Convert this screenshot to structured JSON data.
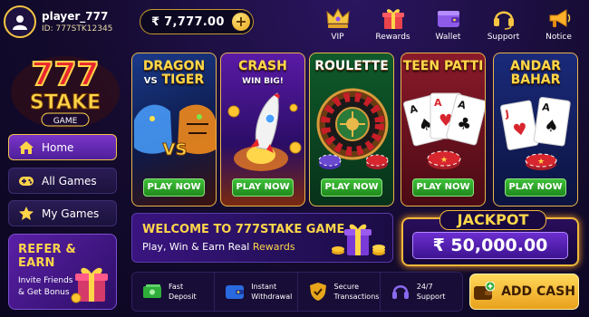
{
  "profile": {
    "username": "player_777",
    "id_text": "ID: 777STK12345"
  },
  "wallet": {
    "balance": "₹ 7,777.00",
    "add_symbol": "+"
  },
  "topnav": [
    {
      "label": "VIP",
      "icon": "crown-icon"
    },
    {
      "label": "Rewards",
      "icon": "gift-icon"
    },
    {
      "label": "Wallet",
      "icon": "wallet-icon"
    },
    {
      "label": "Support",
      "icon": "headset-icon"
    },
    {
      "label": "Notice",
      "icon": "megaphone-icon"
    }
  ],
  "logo": {
    "line1": "777",
    "line2": "STAKE",
    "line3": "GAME"
  },
  "sidebar": {
    "items": [
      {
        "label": "Home",
        "icon": "home-icon",
        "active": true
      },
      {
        "label": "All Games",
        "icon": "gamepad-icon",
        "active": false
      },
      {
        "label": "My Games",
        "icon": "star-icon",
        "active": false
      }
    ],
    "refer": {
      "title": "REFER & EARN",
      "subtitle": "Invite Friends & Get Bonus"
    }
  },
  "games": [
    {
      "title_line1": "DRAGON",
      "title_vs": "VS",
      "title_line2": "TIGER",
      "play_label": "PLAY NOW"
    },
    {
      "title_line1": "CRASH",
      "subtitle": "WIN BIG!",
      "play_label": "PLAY NOW"
    },
    {
      "title_line1": "ROULETTE",
      "play_label": "PLAY NOW"
    },
    {
      "title_line1": "TEEN PATTI",
      "play_label": "PLAY NOW"
    },
    {
      "title_line1": "ANDAR",
      "title_line2": "BAHAR",
      "play_label": "PLAY NOW"
    }
  ],
  "welcome": {
    "title": "WELCOME TO 777STAKE GAME",
    "tagline": "Play, Win & Earn Real",
    "tagline_highlight": "Rewards"
  },
  "jackpot": {
    "label": "JACKPOT",
    "amount": "₹ 50,000.00"
  },
  "features": [
    {
      "label": "Fast\nDeposit",
      "icon": "cash-icon"
    },
    {
      "label": "Instant\nWithdrawal",
      "icon": "withdraw-icon"
    },
    {
      "label": "Secure\nTransactions",
      "icon": "shield-icon"
    },
    {
      "label": "24/7\nSupport",
      "icon": "headset-icon"
    }
  ],
  "add_cash": {
    "label": "ADD CASH"
  },
  "colors": {
    "gold": "#f5c542",
    "purple": "#4e1f9a",
    "green": "#1f8a1c",
    "background": "#140b2e"
  }
}
